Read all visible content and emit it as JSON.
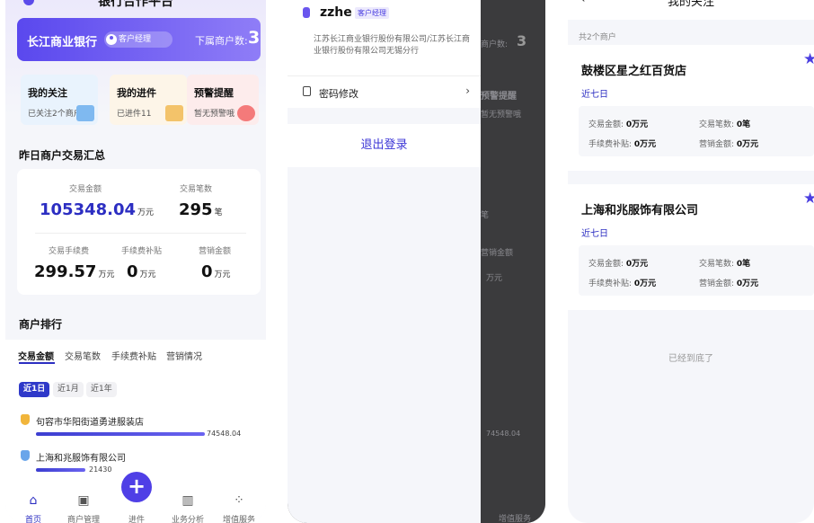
{
  "screen1": {
    "title": "银行合作平台",
    "bank_name": "长江商业银行",
    "role": "客户经理",
    "sub_merchants_label": "下属商户数:",
    "sub_merchants_count": "3",
    "quick_cards": [
      {
        "title": "我的关注",
        "sub": "已关注2个商户"
      },
      {
        "title": "我的进件",
        "sub": "已进件11"
      },
      {
        "title": "预警提醒",
        "sub": "暂无预警哦"
      }
    ],
    "summary_title": "昨日商户交易汇总",
    "summary": {
      "amount_label": "交易金额",
      "amount_value": "105348.04",
      "amount_unit": "万元",
      "count_label": "交易笔数",
      "count_value": "295",
      "count_unit": "笔",
      "fee_label": "交易手续费",
      "fee_value": "299.57",
      "fee_unit": "万元",
      "subsidy_label": "手续费补贴",
      "subsidy_value": "0",
      "subsidy_unit": "万元",
      "marketing_label": "营销金额",
      "marketing_value": "0",
      "marketing_unit": "万元"
    },
    "ranking_title": "商户排行",
    "ranking_tabs": [
      "交易金额",
      "交易笔数",
      "手续费补贴",
      "营销情况"
    ],
    "period_chips": [
      "近1日",
      "近1月",
      "近1年"
    ],
    "ranking": [
      {
        "name": "句容市华阳街道勇进服装店",
        "value": "74548.04",
        "fraction": 1.0
      },
      {
        "name": "上海和兆服饰有限公司",
        "value": "21430",
        "fraction": 0.29
      }
    ],
    "tabbar": [
      "首页",
      "商户管理",
      "进件",
      "业务分析",
      "增值服务"
    ],
    "fab": "+"
  },
  "screen2": {
    "name": "zzhe",
    "role": "客户经理",
    "bank": "江苏长江商业银行股份有限公司/江苏长江商业银行股份有限公司无锡分行",
    "menu_item": "密码修改",
    "logout": "退出登录",
    "ghost": {
      "count_label": "商户数:",
      "count": "3",
      "warn_title": "预警提醒",
      "warn_sub": "暂无预警哦",
      "unit_a": "笔",
      "marketing": "营销金额",
      "unit_b": "万元",
      "value": "74548.04",
      "tab": "增值服务"
    }
  },
  "screen3": {
    "title": "我的关注",
    "count": "共2个商户",
    "merchants": [
      {
        "name": "鼓楼区星之红百货店",
        "period": "近七日",
        "amount": "0万元",
        "count": "0笔",
        "subsidy": "0万元",
        "marketing": "0万元"
      },
      {
        "name": "上海和兆服饰有限公司",
        "period": "近七日",
        "amount": "0万元",
        "count": "0笔",
        "subsidy": "0万元",
        "marketing": "0万元"
      }
    ],
    "labels": {
      "amount": "交易金额:",
      "count": "交易笔数:",
      "subsidy": "手续费补贴:",
      "marketing": "营销金额:"
    },
    "end_text": "已经到底了"
  }
}
